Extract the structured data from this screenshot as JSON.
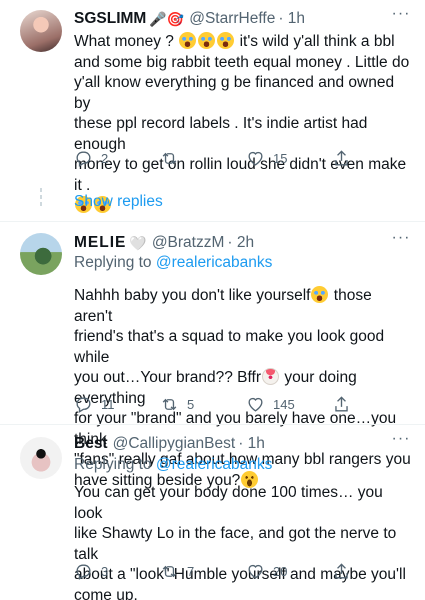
{
  "tweets": [
    {
      "name": "SGSLIMM",
      "name_emojis": "🎤🎯",
      "handle": "@StarrHeffe",
      "time": "· 1h",
      "text_lines": [
        "What money ?",
        "it's wild y'all think a bbl",
        "and some big rabbit teeth equal money . Little do",
        "y'all know everything g be financed and owned by",
        "these ppl record labels . It's indie artist had enough",
        "money to get on rollin loud she didn't even make it ."
      ],
      "replies": "2",
      "retweets": "",
      "likes": "15",
      "show_replies": "Show replies"
    },
    {
      "name": "MELIE",
      "name_emojis": "🤍",
      "handle": "@BratzzM",
      "time": "· 2h",
      "replying_prefix": "Replying to",
      "replying_to": "@realericabanks",
      "text_lines": [
        "Nahhh baby you don't like yourself",
        "those aren't",
        "friend's that's a squad to make you look good while",
        "you out…Your brand?? Bffr",
        "your doing everything",
        "for your \"brand\" and you barely have one…you think",
        "\"fans\" really gaf about how many bbl rangers you",
        "have sitting beside you?"
      ],
      "replies": "11",
      "retweets": "5",
      "likes": "145"
    },
    {
      "name": "Best",
      "handle": "@CallipygianBest",
      "time": "· 1h",
      "replying_prefix": "Replying to",
      "replying_to": "@realericabanks",
      "text_lines": [
        "You can get your body done 100 times… you look",
        "like Shawty Lo in the face, and got the nerve to talk",
        "about a \"look\" Humble yourself and maybe you'll",
        "come up."
      ],
      "replies": "3",
      "retweets": "7",
      "likes": "20"
    }
  ],
  "icons": {
    "reply": "reply-icon",
    "retweet": "retweet-icon",
    "like": "heart-icon",
    "share": "share-icon",
    "more": "more-icon"
  },
  "colors": {
    "link": "#1d9bf0",
    "secondary": "#536471",
    "text": "#0f1419"
  }
}
